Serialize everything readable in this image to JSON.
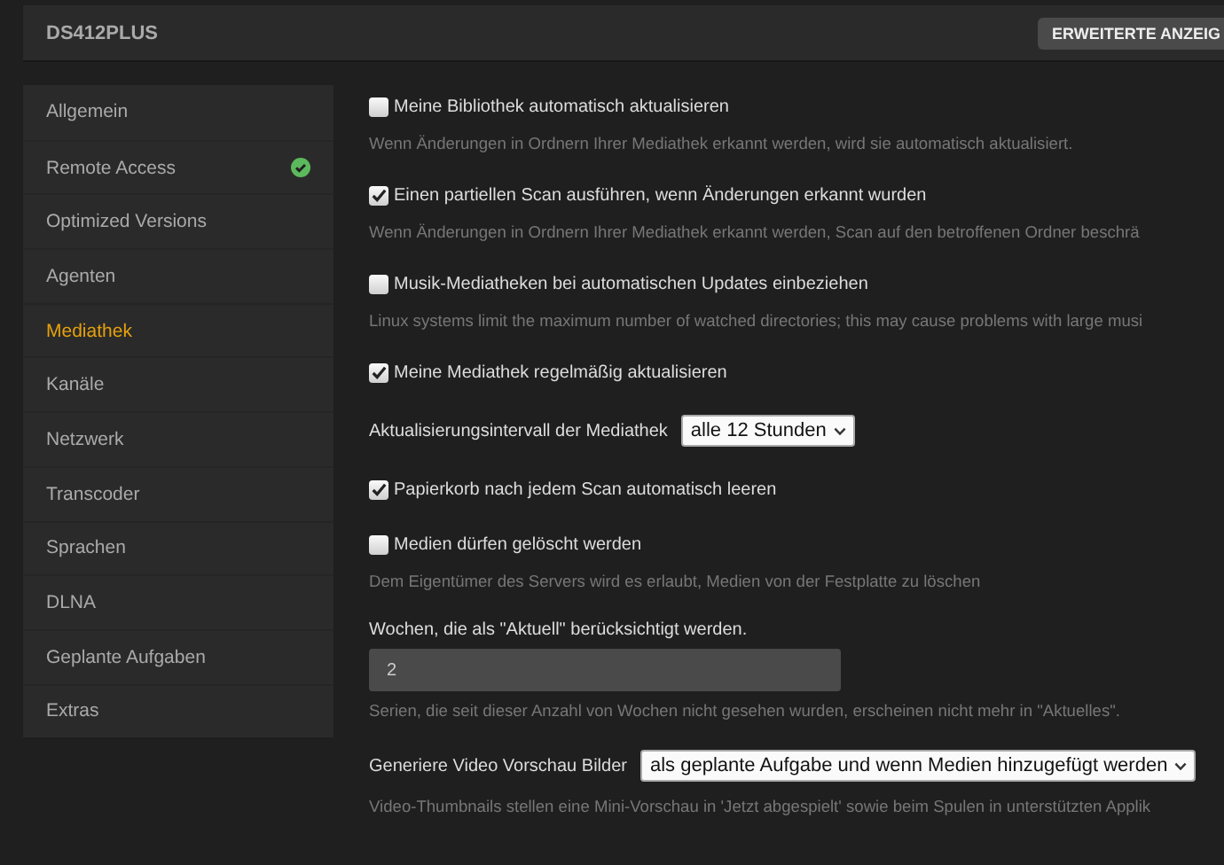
{
  "header": {
    "title": "DS412PLUS",
    "button": "ERWEITERTE ANZEIG"
  },
  "sidebar": {
    "items": [
      {
        "label": "Allgemein",
        "selected": false,
        "connected": false
      },
      {
        "label": "Remote Access",
        "selected": false,
        "connected": true
      },
      {
        "label": "Optimized Versions",
        "selected": false,
        "connected": false
      },
      {
        "label": "Agenten",
        "selected": false,
        "connected": false
      },
      {
        "label": "Mediathek",
        "selected": true,
        "connected": false
      },
      {
        "label": "Kanäle",
        "selected": false,
        "connected": false
      },
      {
        "label": "Netzwerk",
        "selected": false,
        "connected": false
      },
      {
        "label": "Transcoder",
        "selected": false,
        "connected": false
      },
      {
        "label": "Sprachen",
        "selected": false,
        "connected": false
      },
      {
        "label": "DLNA",
        "selected": false,
        "connected": false
      },
      {
        "label": "Geplante Aufgaben",
        "selected": false,
        "connected": false
      },
      {
        "label": "Extras",
        "selected": false,
        "connected": false
      }
    ]
  },
  "settings": [
    {
      "kind": "checkbox",
      "label": "Meine Bibliothek automatisch aktualisieren",
      "checked": false,
      "help": "Wenn Änderungen in Ordnern Ihrer Mediathek erkannt werden, wird sie automatisch aktualisiert."
    },
    {
      "kind": "checkbox",
      "label": "Einen partiellen Scan ausführen, wenn Änderungen erkannt wurden",
      "checked": true,
      "help": "Wenn Änderungen in Ordnern Ihrer Mediathek erkannt werden, Scan auf den betroffenen Ordner beschrä"
    },
    {
      "kind": "checkbox",
      "label": "Musik-Mediatheken bei automatischen Updates einbeziehen",
      "checked": false,
      "help": "Linux systems limit the maximum number of watched directories; this may cause problems with large musi"
    },
    {
      "kind": "checkbox",
      "label": "Meine Mediathek regelmäßig aktualisieren",
      "checked": true
    },
    {
      "kind": "select",
      "label": "Aktualisierungsintervall der Mediathek",
      "value": "alle 12 Stunden"
    },
    {
      "kind": "checkbox",
      "label": "Papierkorb nach jedem Scan automatisch leeren",
      "checked": true
    },
    {
      "kind": "checkbox",
      "label": "Medien dürfen gelöscht werden",
      "checked": false,
      "help": "Dem Eigentümer des Servers wird es erlaubt, Medien von der Festplatte zu löschen"
    },
    {
      "kind": "text",
      "label": "Wochen, die als \"Aktuell\" berücksichtigt werden.",
      "value": "2",
      "help": "Serien, die seit dieser Anzahl von Wochen nicht gesehen wurden, erscheinen nicht mehr in \"Aktuelles\"."
    },
    {
      "kind": "select",
      "label": "Generiere Video Vorschau Bilder",
      "value": "als geplante Aufgabe und wenn Medien hinzugefügt werden",
      "help": "Video-Thumbnails stellen eine Mini-Vorschau in 'Jetzt abgespielt' sowie beim Spulen in unterstützten Applik"
    }
  ]
}
